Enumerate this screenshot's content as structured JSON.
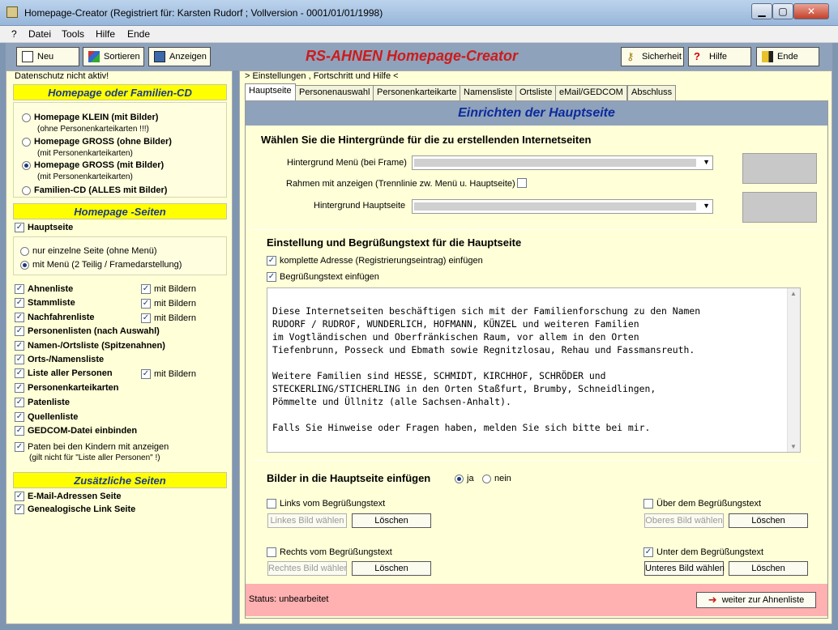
{
  "window": {
    "title": "Homepage-Creator  (Registriert für: Karsten Rudorf ; Vollversion - 0001/01/01/1998)",
    "min": "▁",
    "max": "▢",
    "close": "✕"
  },
  "menubar": [
    "?",
    "Datei",
    "Tools",
    "Hilfe",
    "Ende"
  ],
  "toolbar": {
    "neu": "Neu",
    "sortieren": "Sortieren",
    "anzeigen": "Anzeigen",
    "heading": "RS-AHNEN Homepage-Creator",
    "sicherheit": "Sicherheit",
    "hilfe": "Hilfe",
    "ende": "Ende"
  },
  "left": {
    "datenschutz": "Datenschutz nicht aktiv!",
    "head1": "Homepage oder Familien-CD",
    "radios": [
      {
        "label": "Homepage KLEIN (mit Bilder)",
        "sub": "(ohne Personenkarteikarten !!!)",
        "on": false
      },
      {
        "label": "Homepage GROSS (ohne Bilder)",
        "sub": "(mit Personenkarteikarten)",
        "on": false
      },
      {
        "label": "Homepage GROSS (mit Bilder)",
        "sub": "(mit Personenkarteikarten)",
        "on": true
      },
      {
        "label": "Familien-CD (ALLES mit Bilder)",
        "sub": "",
        "on": false
      }
    ],
    "head2": "Homepage -Seiten",
    "hauptseite": "Hauptseite",
    "mode_single": "nur einzelne Seite (ohne Menü)",
    "mode_menu": "mit Menü (2 Teilig / Framedarstellung)",
    "pages": [
      {
        "label": "Ahnenliste",
        "bilder": "mit Bildern"
      },
      {
        "label": "Stammliste",
        "bilder": "mit Bildern"
      },
      {
        "label": "Nachfahrenliste",
        "bilder": "mit Bildern"
      },
      {
        "label": "Personenlisten (nach Auswahl)",
        "bilder": ""
      },
      {
        "label": "Namen-/Ortsliste (Spitzenahnen)",
        "bilder": ""
      },
      {
        "label": "Orts-/Namensliste",
        "bilder": ""
      },
      {
        "label": "Liste aller Personen",
        "bilder": "mit Bildern"
      },
      {
        "label": "Personenkarteikarten",
        "bilder": ""
      },
      {
        "label": "Patenliste",
        "bilder": ""
      },
      {
        "label": "Quellenliste",
        "bilder": ""
      },
      {
        "label": "GEDCOM-Datei einbinden",
        "bilder": ""
      }
    ],
    "paten": "Paten bei den Kindern mit anzeigen",
    "paten_sub": "(gilt nicht für \"Liste aller Personen\" !)",
    "head3": "Zusätzliche Seiten",
    "extra1": "E-Mail-Adressen Seite",
    "extra2": "Genealogische Link Seite",
    "check": "✓"
  },
  "right": {
    "crumb": "> Einstellungen , Fortschritt und Hilfe <",
    "tabs": [
      "Hauptseite",
      "Personenauswahl",
      "Personenkarteikarte",
      "Namensliste",
      "Ortsliste",
      "eMail/GEDCOM",
      "Abschluss"
    ],
    "section_title": "Einrichten der Hauptseite",
    "bg_heading": "Wählen Sie die Hintergründe für die zu erstellenden Internetseiten",
    "bg_menu": "Hintergrund Menü (bei Frame)",
    "rahmen": "Rahmen mit anzeigen (Trennlinie zw. Menü u. Hauptseite)",
    "bg_main": "Hintergrund Hauptseite",
    "greet_heading": "Einstellung und Begrüßungstext für die Hauptseite",
    "chk_adresse": "komplette Adresse (Registrierungseintrag) einfügen",
    "chk_greet": "Begrüßungstext einfügen",
    "greet_text": "Diese Internetseiten beschäftigen sich mit der Familienforschung zu den Namen\nRUDORF / RUDROF, WUNDERLICH, HOFMANN, KÜNZEL und weiteren Familien\nim Vogtländischen und Oberfränkischen Raum, vor allem in den Orten\nTiefenbrunn, Posseck und Ebmath sowie Regnitzlosau, Rehau und Fassmansreuth.\n\nWeitere Familien sind HESSE, SCHMIDT, KIRCHHOF, SCHRÖDER und\nSTECKERLING/STICHERLING in den Orten Staßfurt, Brumby, Schneidlingen,\nPömmelte und Üllnitz (alle Sachsen-Anhalt).\n\nFalls Sie Hinweise oder Fragen haben, melden Sie sich bitte bei mir.",
    "img_heading": "Bilder in die Hauptseite einfügen",
    "ja": "ja",
    "nein": "nein",
    "links": "Links vom Begrüßungstext",
    "links_btn": "Linkes Bild wählen",
    "ueber": "Über dem Begrüßungstext",
    "ueber_btn": "Oberes Bild wählen",
    "rechts": "Rechts vom Begrüßungstext",
    "rechts_btn": "Rechtes Bild wähler",
    "unter": "Unter dem Begrüßungstext",
    "unter_btn": "Unteres Bild wählen",
    "loeschen": "Löschen",
    "status": "Status: unbearbeitet",
    "next": "weiter zur Ahnenliste"
  }
}
